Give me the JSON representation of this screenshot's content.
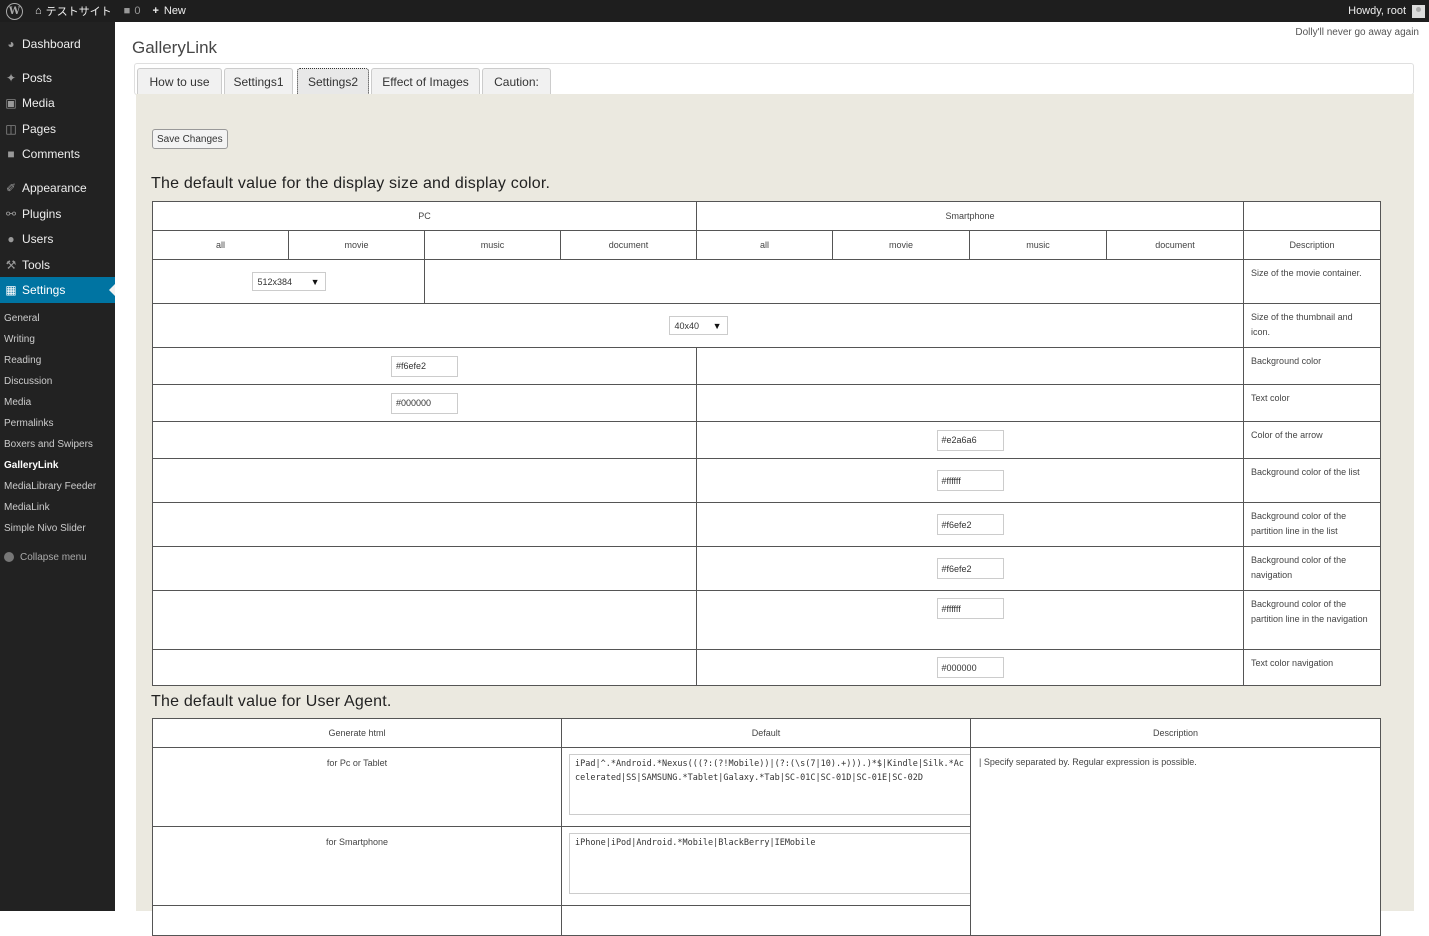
{
  "adminbar": {
    "site_name": "テストサイト",
    "comments_count": "0",
    "new_label": "New",
    "howdy": "Howdy, root"
  },
  "menu": {
    "dashboard": "Dashboard",
    "posts": "Posts",
    "media": "Media",
    "pages": "Pages",
    "comments": "Comments",
    "appearance": "Appearance",
    "plugins": "Plugins",
    "users": "Users",
    "tools": "Tools",
    "settings": "Settings",
    "submenu": [
      "General",
      "Writing",
      "Reading",
      "Discussion",
      "Media",
      "Permalinks",
      "Boxers and Swipers",
      "GalleryLink",
      "MediaLibrary Feeder",
      "MediaLink",
      "Simple Nivo Slider"
    ],
    "collapse": "Collapse menu"
  },
  "dolly": "Dolly'll never go away again",
  "page_title": "GalleryLink",
  "tabs": [
    "How to use",
    "Settings1",
    "Settings2",
    "Effect of Images",
    "Caution:"
  ],
  "save_button": "Save Changes",
  "section1": {
    "heading": "The default value for the display size and display color.",
    "pc": "PC",
    "smartphone": "Smartphone",
    "cols": [
      "all",
      "movie",
      "music",
      "document",
      "all",
      "movie",
      "music",
      "document"
    ],
    "description": "Description",
    "size_select": "512x384",
    "thumb_select": "40x40",
    "rows": {
      "size_desc": "Size of the movie container.",
      "thumb_desc": "Size of the thumbnail and icon.",
      "bg_value": "#f6efe2",
      "bg_desc": "Background color",
      "text_value": "#000000",
      "text_desc": "Text color",
      "arrow_value": "#e2a6a6",
      "arrow_desc": "Color of the arrow",
      "list_bg_value": "#ffffff",
      "list_bg_desc": "Background color of the list",
      "partition_value": "#f6efe2",
      "partition_desc": "Background color of the partition line in the list",
      "nav_bg_value": "#f6efe2",
      "nav_bg_desc": "Background color of the navigation",
      "nav_partition_value": "#ffffff",
      "nav_partition_desc": "Background color of the partition line in the navigation",
      "nav_text_value": "#000000",
      "nav_text_desc": "Text color navigation"
    }
  },
  "section2": {
    "heading": "The default value for User Agent.",
    "col_generate": "Generate html",
    "col_default": "Default",
    "col_description": "Description",
    "pc_label": "for Pc or Tablet",
    "pc_value": "iPad|^.*Android.*Nexus(((?:(?!Mobile))|(?:(\\s(7|10).+))).)*$|Kindle|Silk.*Accelerated|SS|SAMSUNG.*Tablet|Galaxy.*Tab|SC-01C|SC-01D|SC-01E|SC-02D",
    "sp_label": "for Smartphone",
    "sp_value": "iPhone|iPod|Android.*Mobile|BlackBerry|IEMobile",
    "desc": "| Specify separated by. Regular expression is possible."
  }
}
